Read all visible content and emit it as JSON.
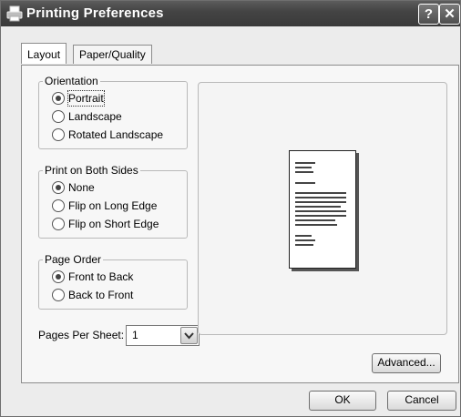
{
  "window": {
    "title": "Printing Preferences",
    "help_label": "?",
    "close_label": "✕"
  },
  "tabs": [
    {
      "label": "Layout",
      "active": true
    },
    {
      "label": "Paper/Quality",
      "active": false
    }
  ],
  "orientation": {
    "legend": "Orientation",
    "options": [
      {
        "label": "Portrait",
        "selected": true
      },
      {
        "label": "Landscape",
        "selected": false
      },
      {
        "label": "Rotated Landscape",
        "selected": false
      }
    ]
  },
  "print_both_sides": {
    "legend": "Print on Both Sides",
    "options": [
      {
        "label": "None",
        "selected": true
      },
      {
        "label": "Flip on Long Edge",
        "selected": false
      },
      {
        "label": "Flip on Short Edge",
        "selected": false
      }
    ]
  },
  "page_order": {
    "legend": "Page Order",
    "options": [
      {
        "label": "Front to Back",
        "selected": true
      },
      {
        "label": "Back to Front",
        "selected": false
      }
    ]
  },
  "pages_per_sheet": {
    "label": "Pages Per Sheet:",
    "value": "1"
  },
  "buttons": {
    "advanced": "Advanced...",
    "ok": "OK",
    "cancel": "Cancel"
  }
}
